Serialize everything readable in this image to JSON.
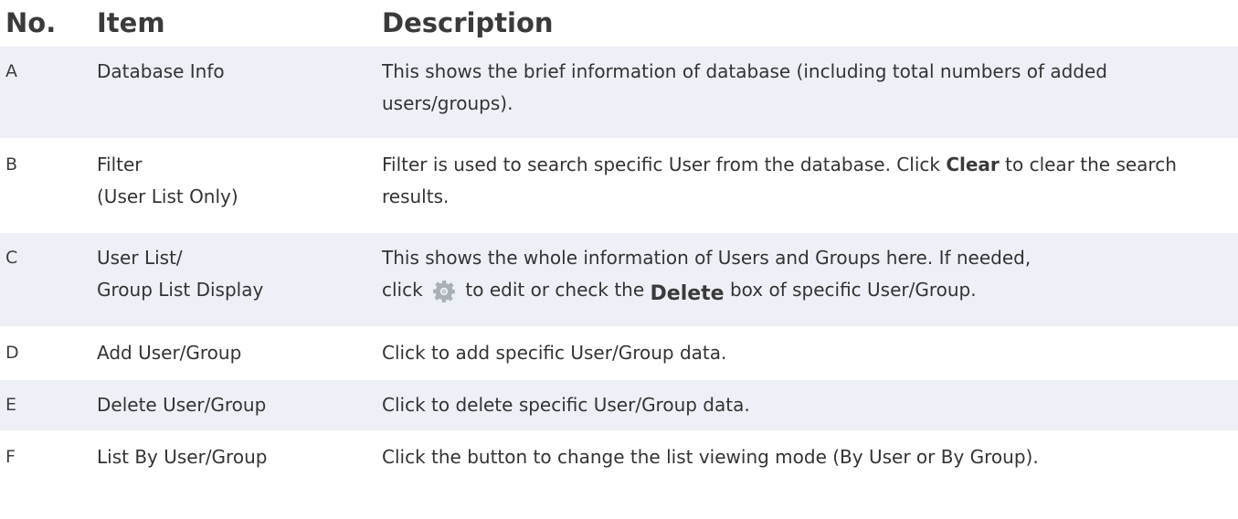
{
  "headers": {
    "no": "No.",
    "item": "Item",
    "description": "Description"
  },
  "rows": [
    {
      "no": "A",
      "item_lines": [
        "Database Info"
      ],
      "desc_text": "This shows the brief information of database (including total numbers of added users/groups)."
    },
    {
      "no": "B",
      "item_lines": [
        "Filter",
        "(User List Only)"
      ],
      "desc_before": "Filter is used to search specific User from the database. Click ",
      "desc_bold": "Clear",
      "desc_after": " to clear the search results."
    },
    {
      "no": "C",
      "item_lines": [
        "User List/",
        "Group List Display"
      ],
      "desc_line1": "This shows the whole information of Users and Groups here. If needed,",
      "desc_before_icon": "click ",
      "icon": "gear-icon",
      "desc_mid": " to edit or check the ",
      "desc_bold": "Delete",
      "desc_after": " box of specific User/Group."
    },
    {
      "no": "D",
      "item_lines": [
        "Add User/Group"
      ],
      "desc_text": "Click to add specific User/Group data."
    },
    {
      "no": "E",
      "item_lines": [
        "Delete User/Group"
      ],
      "desc_text": "Click to delete specific User/Group data."
    },
    {
      "no": "F",
      "item_lines": [
        "List By User/Group"
      ],
      "desc_text": "Click the button to change the list viewing mode (By User or By Group)."
    }
  ],
  "colors": {
    "row_shade": "#eef0f7",
    "text": "#333333"
  }
}
